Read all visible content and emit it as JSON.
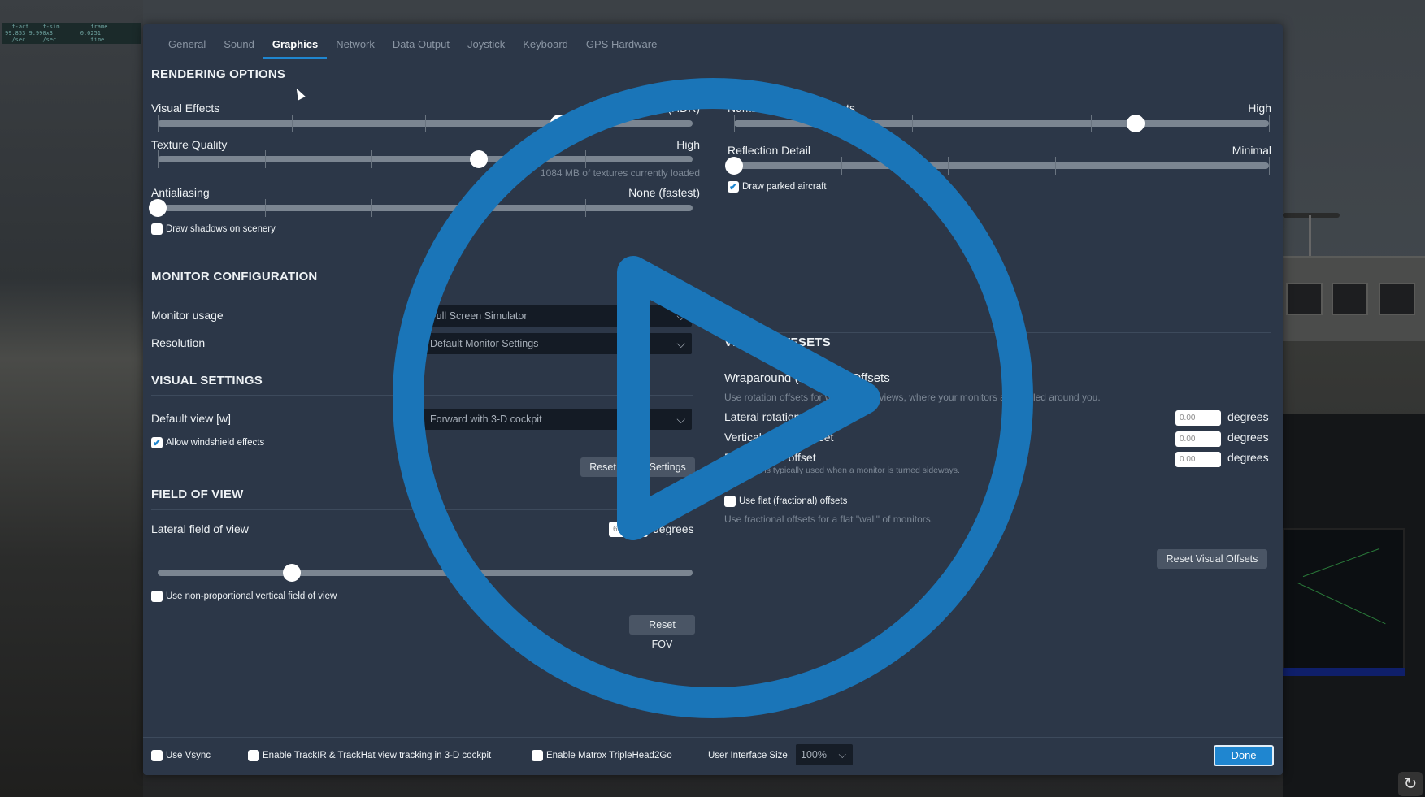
{
  "hud": {
    "line1": "  f-act    f-sim         frame",
    "line2": "99.853 9.990x3        0.0251",
    "line3": "  /sec     /sec          time"
  },
  "tabs": [
    {
      "label": "General",
      "active": false
    },
    {
      "label": "Sound",
      "active": false
    },
    {
      "label": "Graphics",
      "active": true
    },
    {
      "label": "Network",
      "active": false
    },
    {
      "label": "Data Output",
      "active": false
    },
    {
      "label": "Joystick",
      "active": false
    },
    {
      "label": "Keyboard",
      "active": false
    },
    {
      "label": "GPS Hardware",
      "active": false
    }
  ],
  "rendering": {
    "title": "RENDERING OPTIONS",
    "visual_effects": {
      "label": "Visual Effects",
      "value_text": "High (HDR)",
      "level": 0.75
    },
    "texture_quality": {
      "label": "Texture Quality",
      "value_text": "High",
      "level": 0.6,
      "hint": "1084 MB of textures currently loaded"
    },
    "antialiasing": {
      "label": "Antialiasing",
      "value_text": "None (fastest)",
      "level": 0.0
    },
    "draw_shadows": {
      "label": "Draw shadows on scenery",
      "checked": false
    },
    "number_of_objects": {
      "label": "Number of World Objects",
      "value_text": "High",
      "level": 0.75
    },
    "reflection_detail": {
      "label": "Reflection Detail",
      "value_text": "Minimal",
      "level": 0.0
    },
    "draw_parked": {
      "label": "Draw parked aircraft",
      "checked": true
    }
  },
  "monitor": {
    "title": "MONITOR CONFIGURATION",
    "usage": {
      "label": "Monitor usage",
      "value": "Full Screen Simulator"
    },
    "resolution": {
      "label": "Resolution",
      "value": "Default Monitor Settings"
    }
  },
  "visual_settings": {
    "title": "VISUAL SETTINGS",
    "default_view": {
      "label": "Default view [w]",
      "value": "Forward with 3-D cockpit"
    },
    "windshield": {
      "label": "Allow windshield effects",
      "checked": true
    },
    "reset_button": "Reset Visual Settings"
  },
  "fov": {
    "title": "FIELD OF VIEW",
    "lateral": {
      "label": "Lateral field of view",
      "value": "60",
      "unit": "degrees",
      "level": 0.25
    },
    "nonprop": {
      "label": "Use non-proportional vertical field of view",
      "checked": false
    },
    "reset_button": "Reset FOV"
  },
  "offsets": {
    "title": "VISUAL OFFSETS",
    "wrap_title": "Wraparound (Rotation) Offsets",
    "wrap_hint": "Use rotation offsets for wraparound views, where your monitors are angled around you.",
    "lateral": {
      "label": "Lateral rotation offset",
      "value": "0.00",
      "unit": "degrees"
    },
    "vertical": {
      "label": "Vertical rotation offset",
      "value": "0.00",
      "unit": "degrees"
    },
    "roll": {
      "label": "Roll rotation offset",
      "value": "0.00",
      "unit": "degrees",
      "hint": "Roll offset is typically used when a monitor is turned sideways."
    },
    "flat": {
      "label": "Use flat (fractional) offsets",
      "checked": false,
      "hint": "Use fractional offsets for a flat \"wall\" of monitors."
    },
    "reset_button": "Reset Visual Offsets"
  },
  "footer": {
    "vsync": {
      "label": "Use Vsync",
      "checked": false
    },
    "trackir": {
      "label": "Enable TrackIR & TrackHat view tracking in 3-D cockpit",
      "checked": false
    },
    "matrox": {
      "label": "Enable Matrox TripleHead2Go",
      "checked": false
    },
    "ui_size_label": "User Interface Size",
    "ui_size_value": "100%",
    "done": "Done"
  },
  "overlay": {
    "icon": "play-icon",
    "color": "#1a75b8"
  },
  "colors": {
    "accent": "#1f86d0",
    "dialog_bg": "#2c3748"
  }
}
